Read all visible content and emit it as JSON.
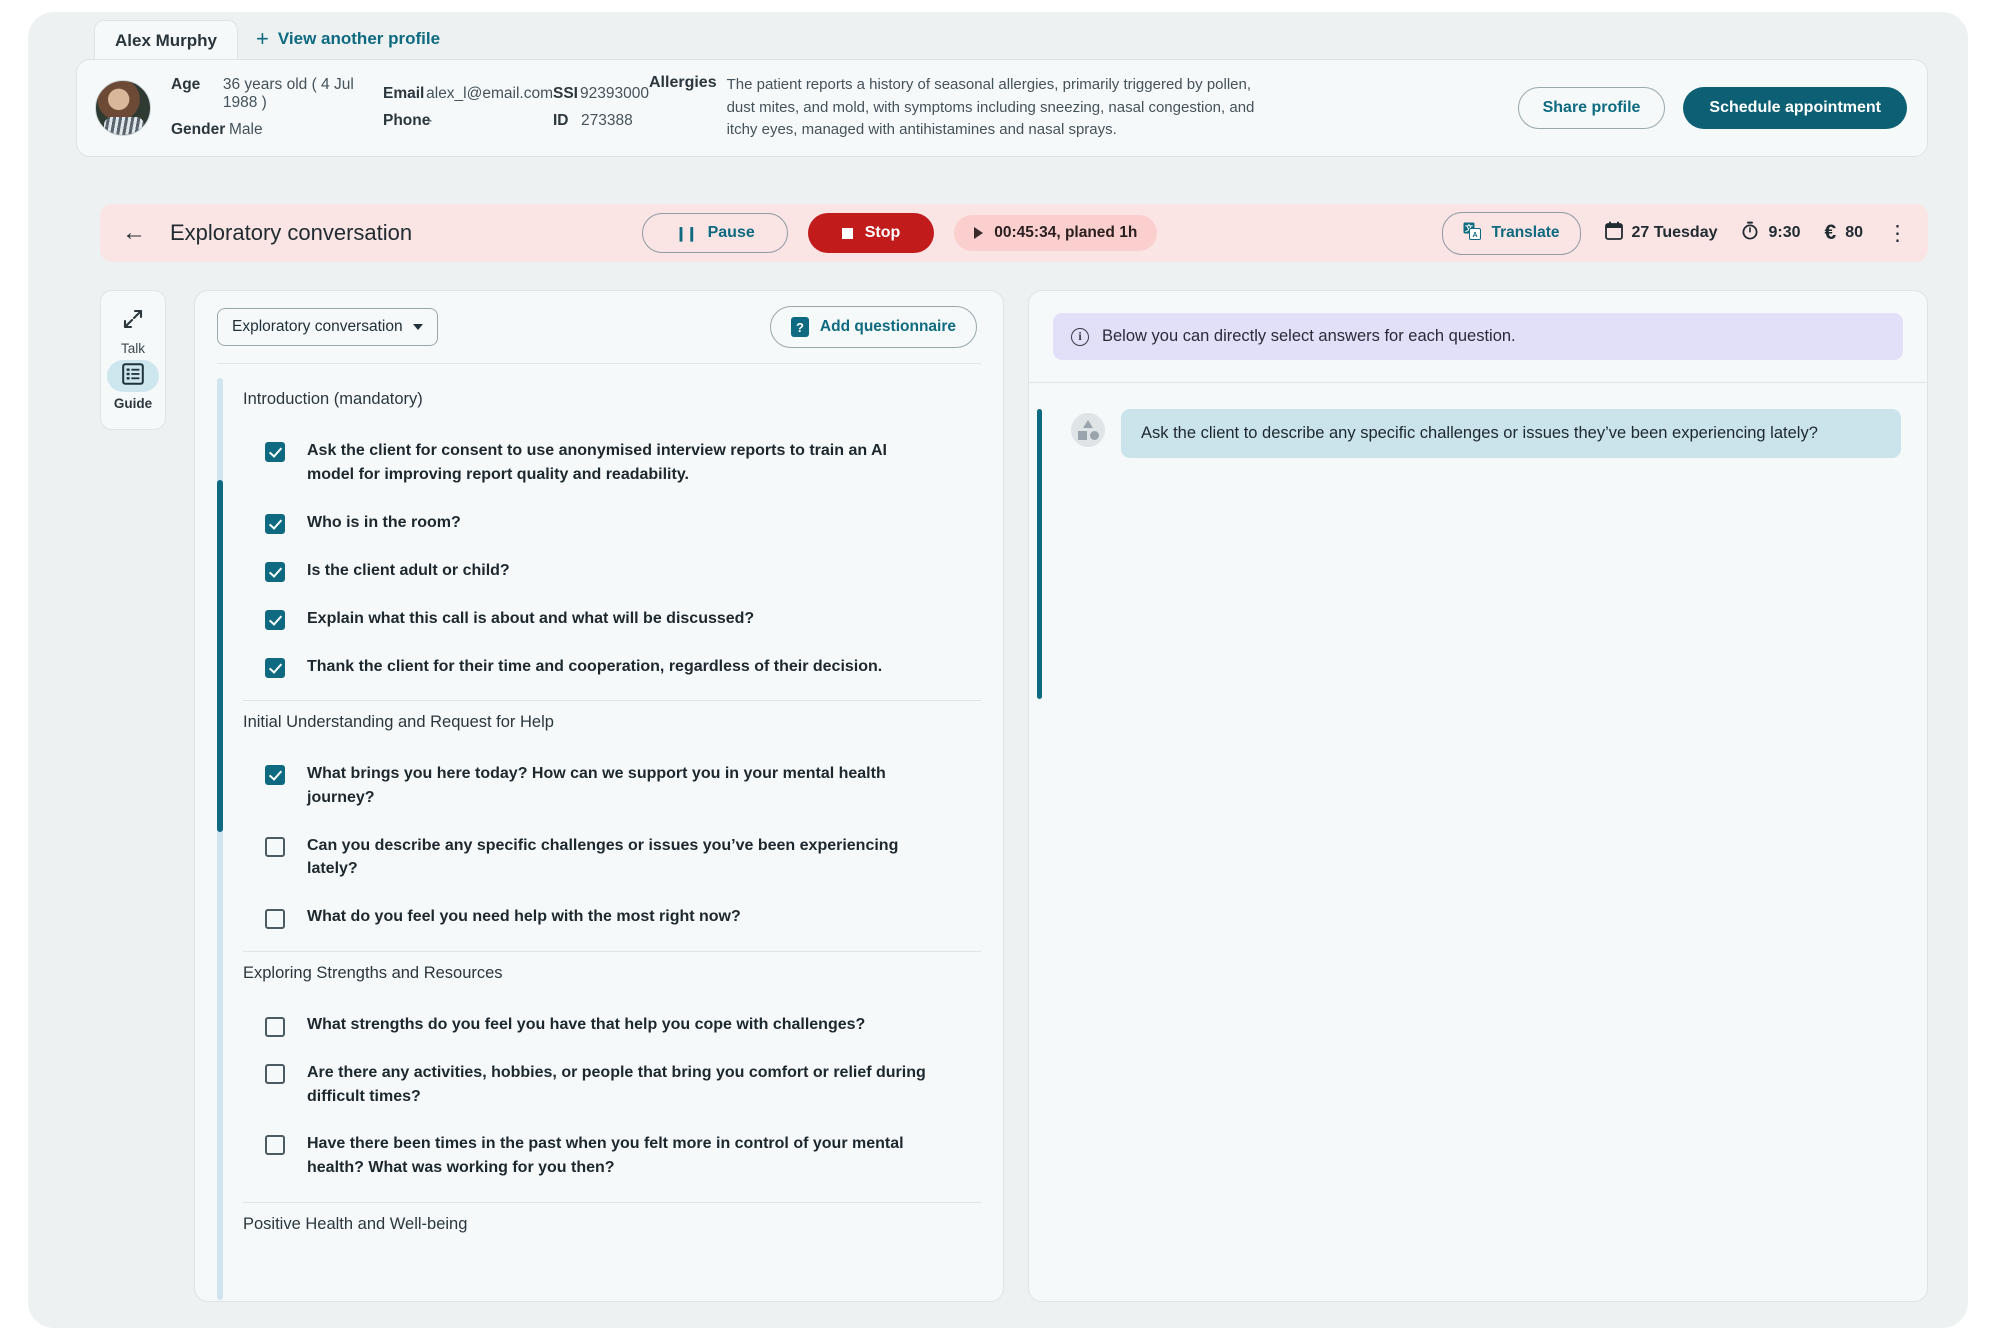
{
  "tabs": {
    "active_tab": "Alex Murphy",
    "add_profile_label": "View another profile",
    "plus": "+"
  },
  "profile": {
    "age_key": "Age",
    "age_value": "36 years old ( 4 Jul 1988 )",
    "gender_key": "Gender",
    "gender_value": "Male",
    "email_key": "Email",
    "email_value": "alex_l@email.com",
    "phone_key": "Phone",
    "phone_value": "-",
    "ssi_key": "SSI",
    "ssi_value": "92393000",
    "id_key": "ID",
    "id_value": "273388",
    "allergies_key": "Allergies",
    "allergies_value": "The patient reports a history of seasonal allergies, primarily triggered by pollen, dust mites, and mold, with symptoms including sneezing, nasal congestion, and itchy eyes, managed with antihistamines and nasal sprays.",
    "share_label": "Share profile",
    "schedule_label": "Schedule appointment"
  },
  "session": {
    "back_icon": "←",
    "title": "Exploratory conversation",
    "pause_label": "Pause",
    "pause_glyph": "❙❙",
    "stop_label": "Stop",
    "timer_text": "00:45:34, planed 1h",
    "translate_label": "Translate",
    "date_text": "27 Tuesday",
    "time_text": "9:30",
    "price_text": "80",
    "currency_glyph": "€",
    "kebab_glyph": "⋮"
  },
  "rail": {
    "talk_label": "Talk",
    "guide_label": "Guide"
  },
  "guide": {
    "dropdown_label": "Exploratory conversation",
    "add_questionnaire_label": "Add questionnaire",
    "question_badge": "?",
    "groups": [
      {
        "title": "Introduction (mandatory)",
        "items": [
          {
            "checked": true,
            "text": "Ask the client for consent to use anonymised interview reports to train an AI model for improving report quality and readability."
          },
          {
            "checked": true,
            "text": "Who is in the room?"
          },
          {
            "checked": true,
            "text": "Is the client adult or child?"
          },
          {
            "checked": true,
            "text": "Explain what this call is about and what will be discussed?"
          },
          {
            "checked": true,
            "text": "Thank the client for their time and cooperation, regardless of their decision."
          }
        ]
      },
      {
        "title": "Initial Understanding and Request for Help",
        "items": [
          {
            "checked": true,
            "text": "What brings you here today? How can we support you in your mental health journey?"
          },
          {
            "checked": false,
            "text": "Can you describe any specific challenges or issues you’ve been experiencing lately?"
          },
          {
            "checked": false,
            "text": " What do you feel you need help with the most right now?"
          }
        ]
      },
      {
        "title": "Exploring Strengths and Resources",
        "items": [
          {
            "checked": false,
            "text": "What strengths do you feel you have that help you cope with challenges?"
          },
          {
            "checked": false,
            "text": "Are there any activities, hobbies, or people that bring you comfort or relief during difficult times?"
          },
          {
            "checked": false,
            "text": "Have there been times in the past when you felt more in control of your mental health? What was working for you then?"
          }
        ]
      },
      {
        "title": "Positive Health and Well-being",
        "items": []
      }
    ]
  },
  "answers": {
    "info_banner": "Below you can directly select answers for each question.",
    "info_glyph": "i",
    "current_question": "Ask the client to describe any specific challenges or issues they’ve been experiencing lately?"
  },
  "colors": {
    "accent": "#0d6a80",
    "accent_dark": "#0d6074",
    "danger": "#c21b1b",
    "session_bg": "#fbe4e4",
    "panel_bg": "#f5f9fa",
    "app_bg": "#eef1f2",
    "info_bg": "#e2e0f8",
    "bubble_bg": "#cbe4ec"
  }
}
